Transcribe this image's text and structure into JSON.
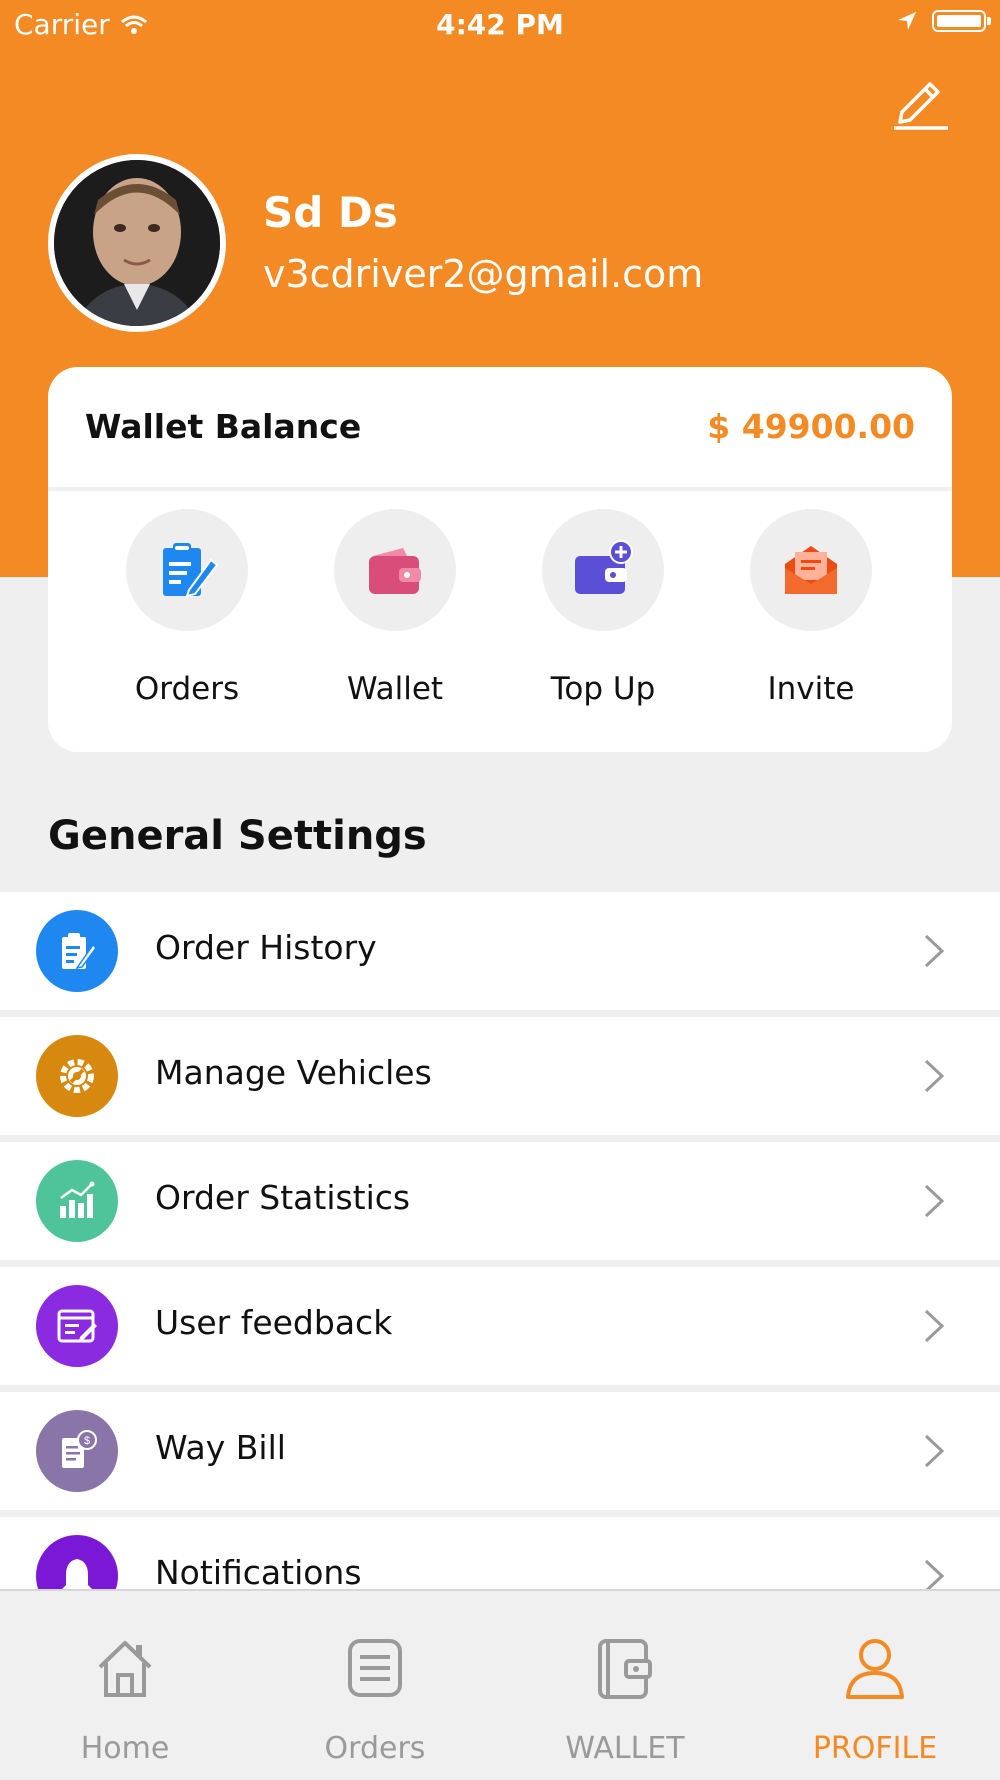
{
  "status_bar": {
    "carrier": "Carrier",
    "time": "4:42 PM"
  },
  "profile": {
    "name": "Sd Ds",
    "email": "v3cdriver2@gmail.com"
  },
  "wallet_card": {
    "title": "Wallet Balance",
    "balance": "$ 49900.00",
    "actions": [
      {
        "label": "Orders",
        "icon": "clipboard-edit-icon",
        "color": "#1e88f0"
      },
      {
        "label": "Wallet",
        "icon": "wallet-icon",
        "color": "#d94d7a"
      },
      {
        "label": "Top Up",
        "icon": "wallet-plus-icon",
        "color": "#5b4fd6"
      },
      {
        "label": "Invite",
        "icon": "envelope-icon",
        "color": "#ee4b10"
      }
    ]
  },
  "general_settings": {
    "title": "General Settings",
    "items": [
      {
        "label": "Order History",
        "icon": "clipboard-edit-icon",
        "color": "#1e88f0"
      },
      {
        "label": "Manage Vehicles",
        "icon": "gear-wrench-icon",
        "color": "#d6890e"
      },
      {
        "label": "Order Statistics",
        "icon": "bar-chart-icon",
        "color": "#4fc49b"
      },
      {
        "label": "User feedback",
        "icon": "feedback-form-icon",
        "color": "#8a2be2"
      },
      {
        "label": "Way Bill",
        "icon": "receipt-dollar-icon",
        "color": "#8a75a8"
      },
      {
        "label": "Notifications",
        "icon": "bell-icon",
        "color": "#7a18d6"
      }
    ]
  },
  "tab_bar": {
    "tabs": [
      {
        "label": "Home",
        "icon": "home-icon",
        "active": false
      },
      {
        "label": "Orders",
        "icon": "list-icon",
        "active": false
      },
      {
        "label": "WALLET",
        "icon": "wallet-icon",
        "active": false
      },
      {
        "label": "PROFILE",
        "icon": "user-icon",
        "active": true
      }
    ]
  },
  "colors": {
    "accent": "#f48a23",
    "background": "#efefef",
    "inactive_tab": "#9a9a9a"
  }
}
